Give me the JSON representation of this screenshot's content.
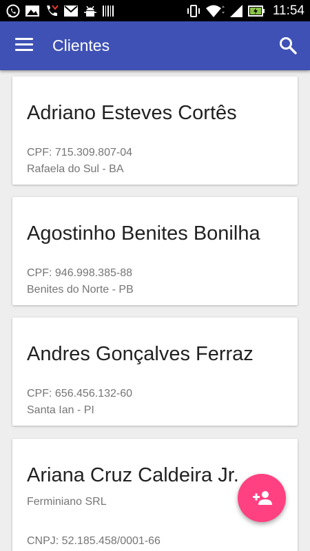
{
  "status_bar": {
    "left_icons": [
      "whatsapp-icon",
      "image-icon",
      "missed-call-icon",
      "gmail-icon",
      "android-debug-icon",
      "barcode-icon"
    ],
    "right_icons": [
      "vibrate-icon",
      "wifi-icon",
      "signal-icon",
      "battery-charging-icon"
    ],
    "time": "11:54"
  },
  "app_bar": {
    "title": "Clientes",
    "menu_icon": "menu-icon",
    "search_icon": "search-icon",
    "color": "#3f51b5"
  },
  "clients": [
    {
      "name": "Adriano Esteves Cortês",
      "line1": "CPF: 715.309.807-04",
      "line2": "Rafaela do Sul - BA"
    },
    {
      "name": "Agostinho Benites Bonilha",
      "line1": "CPF: 946.998.385-88",
      "line2": "Benites do Norte - PB"
    },
    {
      "name": "Andres Gonçalves Ferraz",
      "line1": "CPF: 656.456.132-60",
      "line2": "Santa Ian - PI"
    },
    {
      "name": "Ariana Cruz Caldeira Jr.",
      "line1": "Ferminiano SRL",
      "line2": "CNPJ: 52.185.458/0001-66"
    }
  ],
  "fab": {
    "icon": "add-person-icon",
    "color": "#ff4081"
  }
}
